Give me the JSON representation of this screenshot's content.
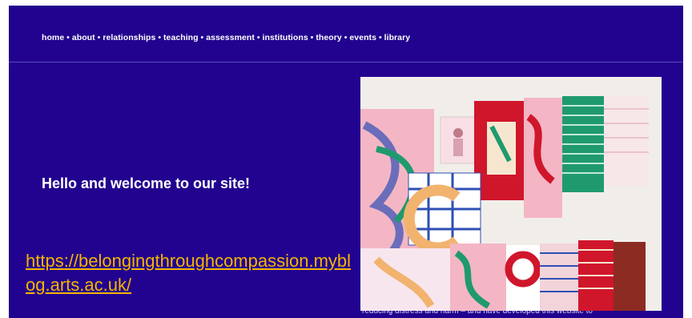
{
  "nav": {
    "text": "home • about • relationships • teaching • assessment • institutions • theory • events • library"
  },
  "hero": {
    "welcome": "Hello and welcome to our site!",
    "link": "https://belongingthroughcompassion.myblog.arts.ac.uk/"
  },
  "partial_text": "reducing distress and harm – and have developed this website to",
  "image": {
    "icon": "textile-collage-photo",
    "colors": {
      "wall": "#f1eeea",
      "red": "#d0162b",
      "pink": "#f4b6c4",
      "green": "#1f9a6e",
      "blue": "#2f4fb6",
      "cream": "#f6e6cf"
    }
  }
}
